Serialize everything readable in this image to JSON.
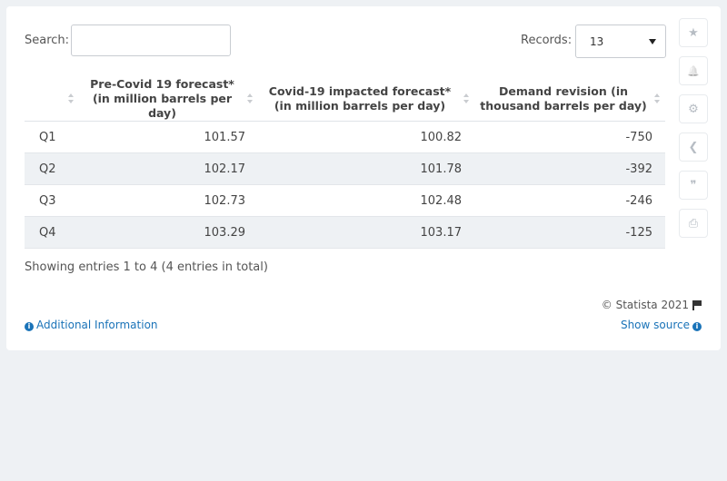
{
  "search": {
    "label": "Search:",
    "value": "",
    "placeholder": ""
  },
  "records": {
    "label": "Records:",
    "selected": "13"
  },
  "table": {
    "headers": [
      "",
      "Pre-Covid 19 forecast* (in million barrels per day)",
      "Covid-19 impacted forecast* (in million barrels per day)",
      "Demand revision (in thousand barrels per day)"
    ],
    "rows": [
      [
        "Q1",
        "101.57",
        "100.82",
        "-750"
      ],
      [
        "Q2",
        "102.17",
        "101.78",
        "-392"
      ],
      [
        "Q3",
        "102.73",
        "102.48",
        "-246"
      ],
      [
        "Q4",
        "103.29",
        "103.17",
        "-125"
      ]
    ]
  },
  "footer": {
    "showing": "Showing entries 1 to 4 (4 entries in total)",
    "copyright": "© Statista 2021",
    "additional_info": "Additional Information",
    "show_source": "Show source"
  },
  "sidebar": {
    "icons": [
      "star-icon",
      "bell-icon",
      "gear-icon",
      "share-icon",
      "quote-icon",
      "print-icon"
    ],
    "glyphs": [
      "★",
      "🔔",
      "⚙",
      "❮",
      "❞",
      "⎙"
    ]
  }
}
